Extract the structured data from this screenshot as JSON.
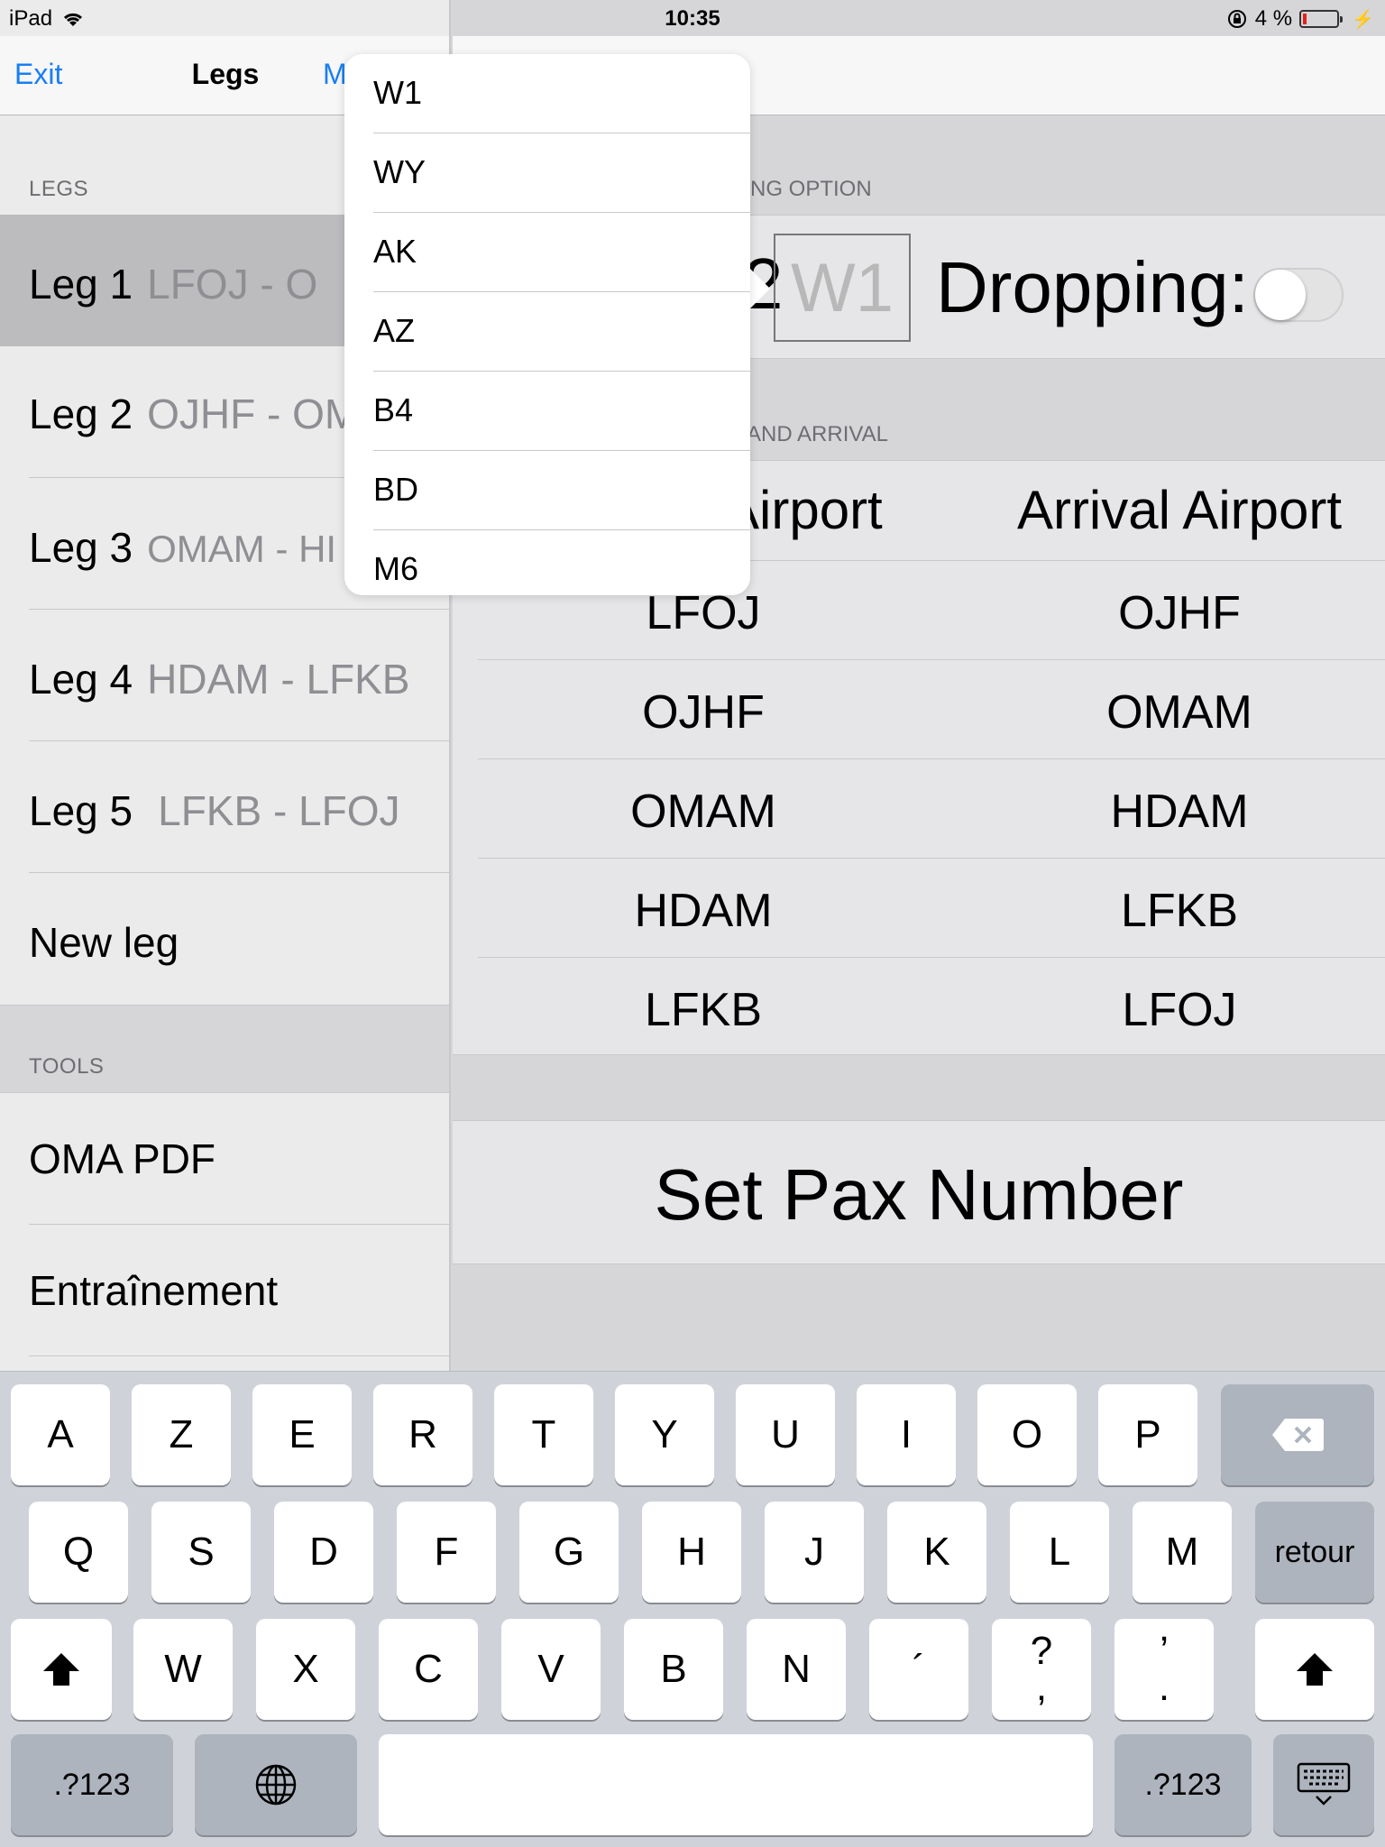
{
  "status_bar": {
    "device": "iPad",
    "time": "10:35",
    "battery_percent": "4 %"
  },
  "nav": {
    "left": "Exit",
    "title": "Legs",
    "right": "M"
  },
  "master": {
    "legs_header": "LEGS",
    "legs": [
      {
        "name": "Leg 1",
        "route": "LFOJ - O"
      },
      {
        "name": "Leg 2",
        "route": "OJHF - OM"
      },
      {
        "name": "Leg 3",
        "route": "OMAM - HI"
      },
      {
        "name": "Leg 4",
        "route": "HDAM - LFKB"
      },
      {
        "name": "Leg 5",
        "route": "LFKB - LFOJ"
      }
    ],
    "new_leg": "New leg",
    "tools_header": "TOOLS",
    "tools": [
      "OMA PDF",
      "Entraînement"
    ]
  },
  "detail": {
    "option_header": "NG OPTION",
    "option_value": "W1",
    "option_prefix": "2",
    "dropping_label": "Dropping:",
    "dropping_enabled": false,
    "arrival_header": "AND ARRIVAL",
    "dep_header": "Airport",
    "arr_header": "Arrival Airport",
    "rows": [
      {
        "dep": "LFOJ",
        "arr": "OJHF"
      },
      {
        "dep": "OJHF",
        "arr": "OMAM"
      },
      {
        "dep": "OMAM",
        "arr": "HDAM"
      },
      {
        "dep": "HDAM",
        "arr": "LFKB"
      },
      {
        "dep": "LFKB",
        "arr": "LFOJ"
      }
    ],
    "set_pax": "Set Pax Number"
  },
  "popover": {
    "items": [
      "W1",
      "WY",
      "AK",
      "AZ",
      "B4",
      "BD",
      "M6"
    ]
  },
  "keyboard": {
    "row1": [
      "A",
      "Z",
      "E",
      "R",
      "T",
      "Y",
      "U",
      "I",
      "O",
      "P"
    ],
    "row2": [
      "Q",
      "S",
      "D",
      "F",
      "G",
      "H",
      "J",
      "K",
      "L",
      "M"
    ],
    "return": "retour",
    "row3": [
      "W",
      "X",
      "C",
      "V",
      "B",
      "N",
      "´"
    ],
    "q_top": "?",
    "q_bottom": ",",
    "a_top": "’",
    "a_bottom": ".",
    "numbers": ".?123"
  }
}
